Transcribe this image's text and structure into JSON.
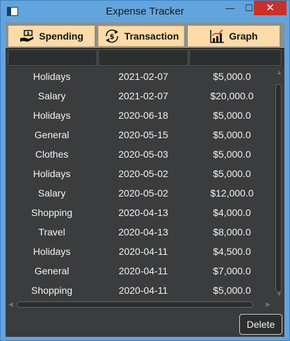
{
  "window": {
    "title": "Expense Tracker",
    "minimize": "—",
    "maximize": "☐",
    "close": "✕"
  },
  "tabs": [
    {
      "label": "Spending",
      "icon": "hand-money-icon"
    },
    {
      "label": "Transaction",
      "icon": "exchange-dollar-icon",
      "selected": true
    },
    {
      "label": "Graph",
      "icon": "bar-chart-icon"
    }
  ],
  "table": {
    "columns": [
      "",
      "",
      ""
    ],
    "rows": [
      {
        "category": "Holidays",
        "date": "2021-02-07",
        "amount": "$5,000.0"
      },
      {
        "category": "Salary",
        "date": "2021-02-07",
        "amount": "$20,000.0"
      },
      {
        "category": "Holidays",
        "date": "2020-06-18",
        "amount": "$5,000.0"
      },
      {
        "category": "General",
        "date": "2020-05-15",
        "amount": "$5,000.0"
      },
      {
        "category": "Clothes",
        "date": "2020-05-03",
        "amount": "$5,000.0"
      },
      {
        "category": "Holidays",
        "date": "2020-05-02",
        "amount": "$5,000.0"
      },
      {
        "category": "Salary",
        "date": "2020-05-02",
        "amount": "$12,000.0"
      },
      {
        "category": "Shopping",
        "date": "2020-04-13",
        "amount": "$4,000.0"
      },
      {
        "category": "Travel",
        "date": "2020-04-13",
        "amount": "$8,000.0"
      },
      {
        "category": "Holidays",
        "date": "2020-04-11",
        "amount": "$4,500.0"
      },
      {
        "category": "General",
        "date": "2020-04-11",
        "amount": "$7,000.0"
      },
      {
        "category": "Shopping",
        "date": "2020-04-11",
        "amount": "$5,000.0"
      }
    ]
  },
  "actions": {
    "delete_label": "Delete"
  },
  "colors": {
    "titlebar": "#62a4dc",
    "tab_bg": "#fcdba6",
    "table_bg": "#3a3c3e",
    "close_button": "#c7312b"
  }
}
